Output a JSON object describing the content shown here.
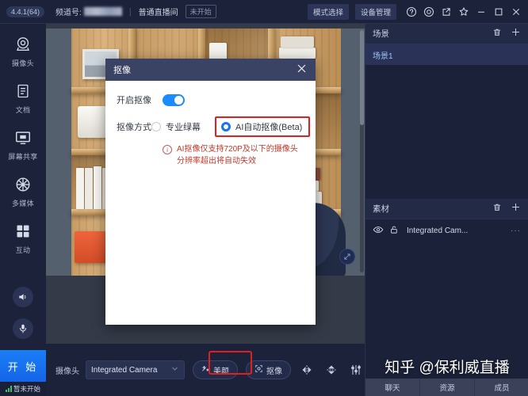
{
  "titlebar": {
    "version": "4.4.1(64)",
    "channel_label": "频道号:",
    "channel_value_masked": "",
    "separator": "|",
    "room_type": "普通直播间",
    "status": "未开始",
    "mode_select": "模式选择",
    "device_manage": "设备管理",
    "icons": [
      "help-icon",
      "target-icon",
      "share-icon",
      "pin-icon",
      "minimize-icon",
      "maximize-icon",
      "close-icon"
    ]
  },
  "sidebar": {
    "items": [
      {
        "label": "摄像头",
        "icon": "camera-icon"
      },
      {
        "label": "文档",
        "icon": "document-icon"
      },
      {
        "label": "屏幕共享",
        "icon": "screen-share-icon"
      },
      {
        "label": "多媒体",
        "icon": "multimedia-icon"
      },
      {
        "label": "互动",
        "icon": "interaction-icon"
      }
    ],
    "speaker_icon": "speaker-icon",
    "mic_icon": "microphone-icon",
    "start_button": "开 始",
    "status_text": "暂未开始"
  },
  "bottombar": {
    "camera_label": "摄像头",
    "camera_value": "Integrated Camera",
    "beauty_button": "美颜",
    "keying_button": "抠像",
    "flip_h_icon": "flip-horizontal-icon",
    "flip_v_icon": "flip-vertical-icon",
    "adjust_icon": "adjust-sliders-icon"
  },
  "rightpanel": {
    "scene": {
      "title": "场景",
      "delete_icon": "trash-icon",
      "add_icon": "plus-icon",
      "items": [
        "场景1"
      ]
    },
    "asset": {
      "title": "素材",
      "delete_icon": "trash-icon",
      "add_icon": "plus-icon",
      "rows": [
        {
          "name": "Integrated Cam...",
          "visible_icon": "eye-icon",
          "lock_icon": "unlock-icon",
          "more": "···"
        }
      ]
    },
    "watermark": "知乎 @保利威直播",
    "tabs": [
      "聊天",
      "资源",
      "成员"
    ]
  },
  "modal": {
    "title": "抠像",
    "close_icon": "close-icon",
    "enable_label": "开启抠像",
    "enable_on": true,
    "mode_label": "抠像方式",
    "options": [
      {
        "label": "专业绿幕",
        "selected": false
      },
      {
        "label": "AI自动抠像(Beta)",
        "selected": true
      }
    ],
    "warning_icon": "info-icon",
    "warning_text": "AI抠像仅支持720P及以下的摄像头分辨率超出将自动失效"
  },
  "colors": {
    "accent_blue": "#1a7ef5",
    "panel_dark": "#1c2239",
    "highlight_red": "#e02020",
    "warning_red": "#c0392b"
  }
}
